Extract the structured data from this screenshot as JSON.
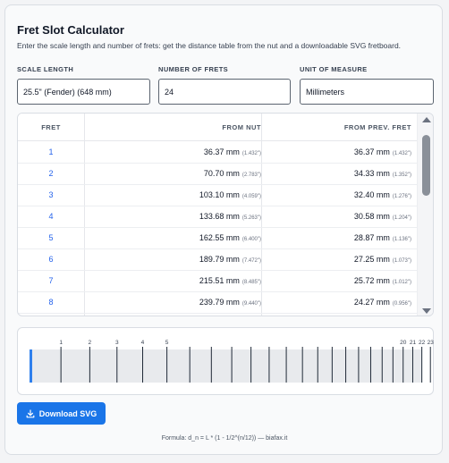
{
  "title": "Fret Slot Calculator",
  "subtitle": "Enter the scale length and number of frets: get the distance table from the nut and a downloadable SVG fretboard.",
  "fields": {
    "scale_label": "SCALE LENGTH",
    "scale_value": "25.5\" (Fender) (648 mm)",
    "frets_label": "NUMBER OF FRETS",
    "frets_value": "24",
    "unit_label": "UNIT OF MEASURE",
    "unit_value": "Millimeters"
  },
  "table": {
    "headers": [
      "FRET",
      "FROM NUT",
      "FROM PREV. FRET"
    ],
    "rows": [
      {
        "fret": "1",
        "nut": "36.37 mm",
        "nut_in": "(1.432\")",
        "prev": "36.37 mm",
        "prev_in": "(1.432\")"
      },
      {
        "fret": "2",
        "nut": "70.70 mm",
        "nut_in": "(2.783\")",
        "prev": "34.33 mm",
        "prev_in": "(1.352\")"
      },
      {
        "fret": "3",
        "nut": "103.10 mm",
        "nut_in": "(4.059\")",
        "prev": "32.40 mm",
        "prev_in": "(1.276\")"
      },
      {
        "fret": "4",
        "nut": "133.68 mm",
        "nut_in": "(5.263\")",
        "prev": "30.58 mm",
        "prev_in": "(1.204\")"
      },
      {
        "fret": "5",
        "nut": "162.55 mm",
        "nut_in": "(6.400\")",
        "prev": "28.87 mm",
        "prev_in": "(1.136\")"
      },
      {
        "fret": "6",
        "nut": "189.79 mm",
        "nut_in": "(7.472\")",
        "prev": "27.25 mm",
        "prev_in": "(1.073\")"
      },
      {
        "fret": "7",
        "nut": "215.51 mm",
        "nut_in": "(8.485\")",
        "prev": "25.72 mm",
        "prev_in": "(1.012\")"
      },
      {
        "fret": "8",
        "nut": "239.79 mm",
        "nut_in": "(9.440\")",
        "prev": "24.27 mm",
        "prev_in": "(0.956\")"
      }
    ]
  },
  "fretboard": {
    "scale_mm": 648,
    "fret_count": 24,
    "labeled_frets": [
      "1",
      "2",
      "3",
      "4",
      "5",
      "20",
      "21",
      "22",
      "23",
      "24"
    ],
    "nut_color": "#2f80ed"
  },
  "download_label": "Download SVG",
  "formula": "Formula: d_n = L * (1 - 1/2^(n/12)) — biafax.it",
  "colors": {
    "accent": "#1a75e8",
    "link": "#2563eb"
  }
}
